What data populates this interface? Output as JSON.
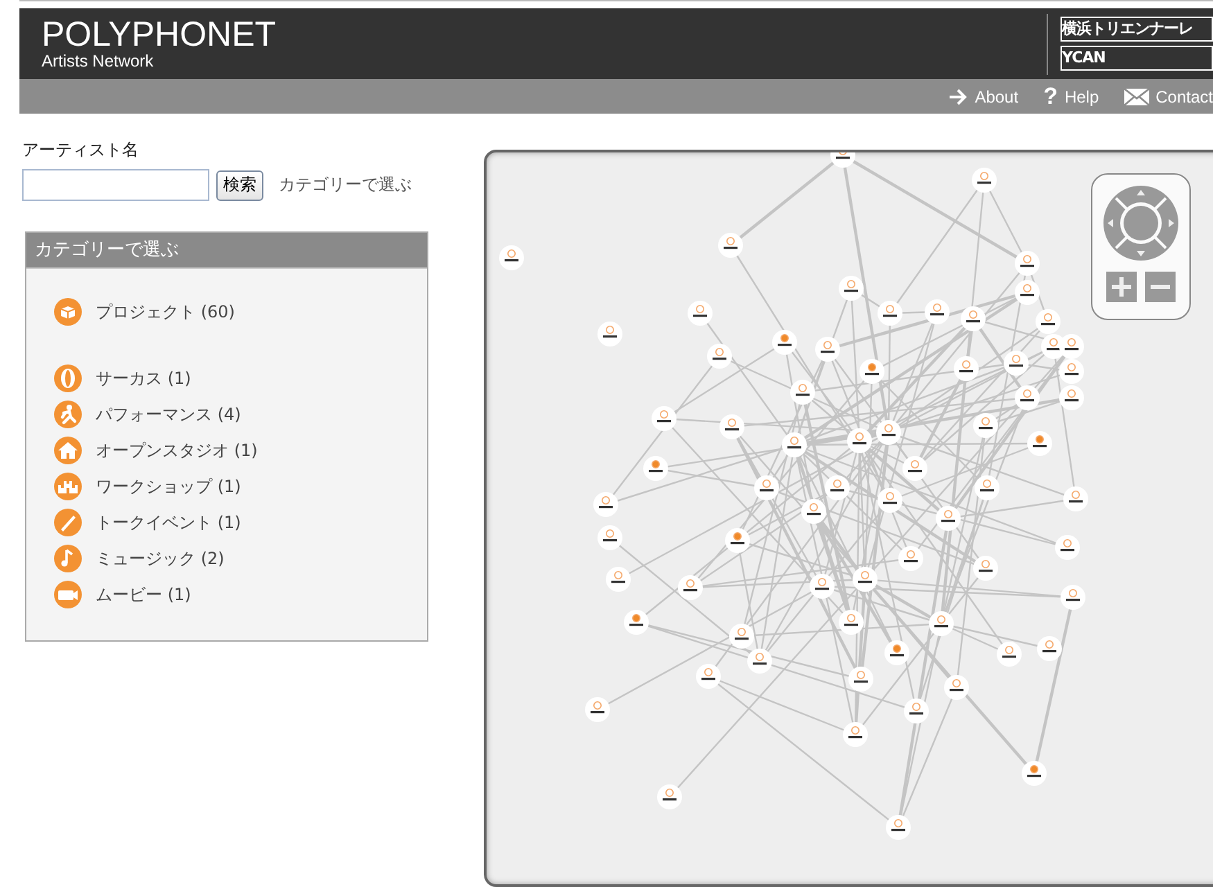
{
  "header": {
    "title": "POLYPHONET",
    "subtitle": "Artists Network",
    "partners": [
      "横浜トリエンナーレ",
      "YCAN"
    ]
  },
  "nav": [
    {
      "kind": "arrow",
      "label": "About"
    },
    {
      "kind": "help",
      "glyph": "?",
      "label": "Help"
    },
    {
      "kind": "mail",
      "label": "Contact"
    }
  ],
  "search": {
    "label": "アーティスト名",
    "button": "検索",
    "link": "カテゴリーで選ぶ"
  },
  "categories": {
    "title": "カテゴリーで選ぶ",
    "items": [
      {
        "kind": "project",
        "label": "プロジェクト (60)"
      },
      {
        "kind": "circus",
        "label": "サーカス (1)"
      },
      {
        "kind": "performance",
        "label": "パフォーマンス (4)"
      },
      {
        "kind": "studio",
        "label": "オープンスタジオ (1)"
      },
      {
        "kind": "workshop",
        "label": "ワークショップ (1)"
      },
      {
        "kind": "talk",
        "label": "トークイベント (1)"
      },
      {
        "kind": "music",
        "label": "ミュージック (2)"
      },
      {
        "kind": "movie",
        "label": "ムービー (1)"
      }
    ]
  }
}
